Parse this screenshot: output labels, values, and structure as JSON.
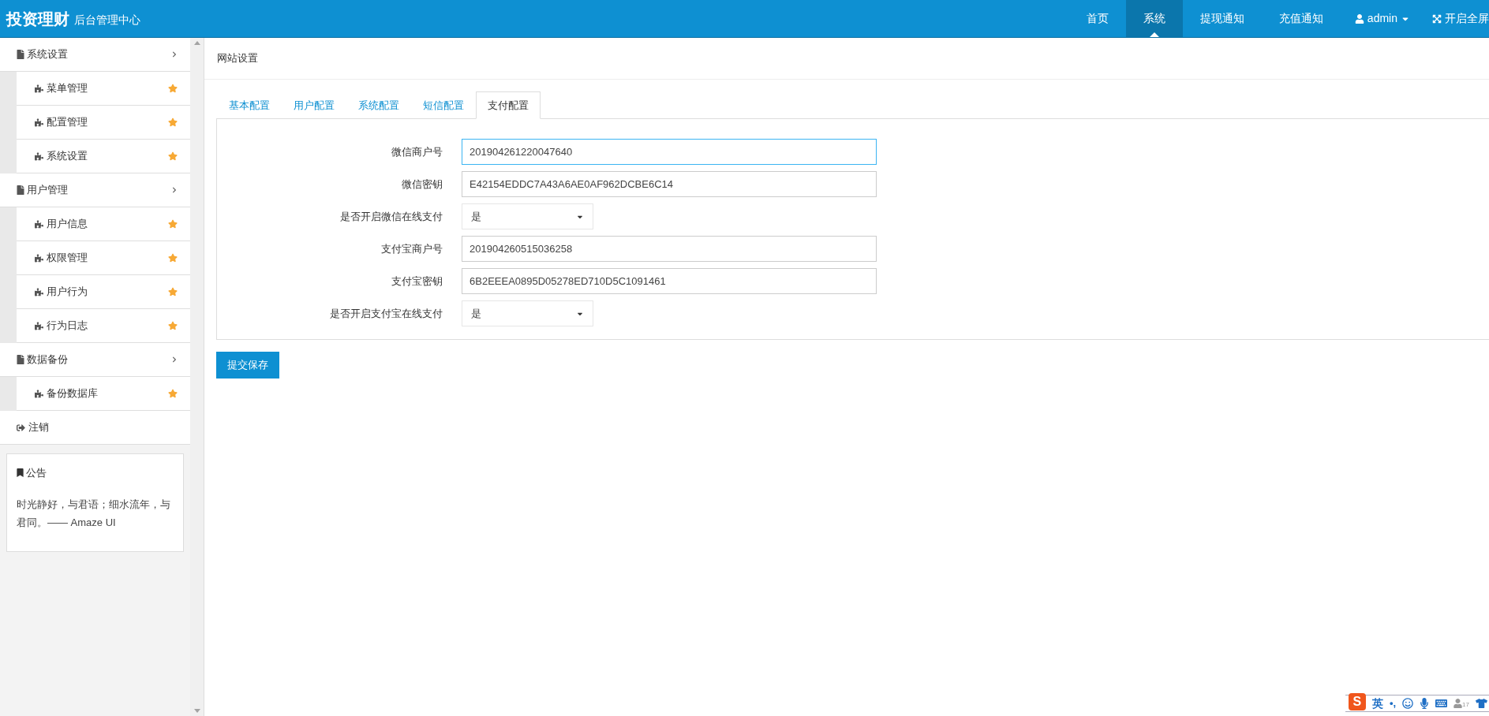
{
  "header": {
    "brand": "投资理财",
    "subtitle": "后台管理中心",
    "nav": [
      {
        "label": "首页",
        "selected": false
      },
      {
        "label": "系统",
        "selected": true
      },
      {
        "label": "提现通知",
        "selected": false
      },
      {
        "label": "充值通知",
        "selected": false
      }
    ],
    "user": "admin",
    "fullscreen": "开启全屏"
  },
  "sidebar": {
    "groups": [
      {
        "label": "系统设置",
        "expanded": true,
        "children": [
          {
            "label": "菜单管理"
          },
          {
            "label": "配置管理"
          },
          {
            "label": "系统设置"
          }
        ]
      },
      {
        "label": "用户管理",
        "expanded": true,
        "children": [
          {
            "label": "用户信息"
          },
          {
            "label": "权限管理"
          },
          {
            "label": "用户行为"
          },
          {
            "label": "行为日志"
          }
        ]
      },
      {
        "label": "数据备份",
        "expanded": true,
        "children": [
          {
            "label": "备份数据库"
          }
        ]
      }
    ],
    "logout": "注销",
    "notice": {
      "title": "公告",
      "text": "时光静好，与君语；细水流年，与君同。—— Amaze UI"
    }
  },
  "page_title": "网站设置",
  "tabs": [
    {
      "label": "基本配置",
      "selected": false
    },
    {
      "label": "用户配置",
      "selected": false
    },
    {
      "label": "系统配置",
      "selected": false
    },
    {
      "label": "短信配置",
      "selected": false
    },
    {
      "label": "支付配置",
      "selected": true
    }
  ],
  "fields": [
    {
      "kind": "text",
      "label": "微信商户号",
      "value": "201904261220047640",
      "focused": true
    },
    {
      "kind": "text",
      "label": "微信密钥",
      "value": "E42154EDDC7A43A6AE0AF962DCBE6C14",
      "focused": false
    },
    {
      "kind": "select",
      "label": "是否开启微信在线支付",
      "value": "是",
      "focused": false
    },
    {
      "kind": "text",
      "label": "支付宝商户号",
      "value": "201904260515036258",
      "focused": false
    },
    {
      "kind": "text",
      "label": "支付宝密钥",
      "value": "6B2EEEA0895D05278ED710D5C1091461",
      "focused": false
    },
    {
      "kind": "select",
      "label": "是否开启支付宝在线支付",
      "value": "是",
      "focused": false
    }
  ],
  "submit": "提交保存",
  "ime": {
    "logo": "S",
    "lang": "英",
    "punct": "•,",
    "badge": "17"
  }
}
